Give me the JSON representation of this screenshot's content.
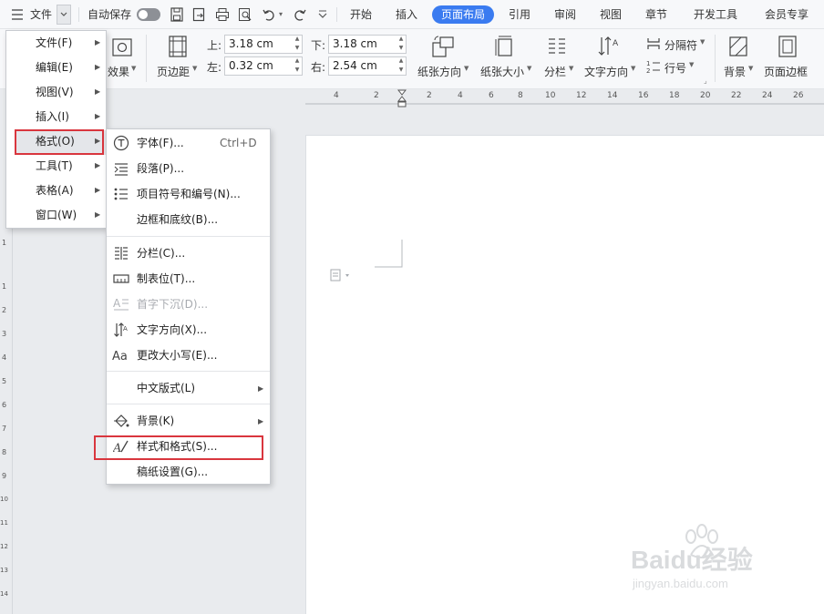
{
  "topbar": {
    "file_label": "文件",
    "autosave_label": "自动保存",
    "tabs": [
      "开始",
      "插入",
      "页面布局",
      "引用",
      "审阅",
      "视图",
      "章节",
      "开发工具",
      "会员专享"
    ],
    "active_tab": "页面布局"
  },
  "ribbon": {
    "effects_label": "效果",
    "margins_label": "页边距",
    "top_label": "上:",
    "top_value": "3.18 cm",
    "bottom_label": "下:",
    "bottom_value": "3.18 cm",
    "left_label": "左:",
    "left_value": "0.32 cm",
    "right_label": "右:",
    "right_value": "2.54 cm",
    "orientation_label": "纸张方向",
    "size_label": "纸张大小",
    "columns_label": "分栏",
    "text_direction_label": "文字方向",
    "separator_label": "分隔符",
    "line_number_label": "行号",
    "background_label": "背景",
    "page_border_label": "页面边框"
  },
  "ruler": {
    "h_numbers": [
      "4",
      "2",
      "2",
      "4",
      "6",
      "8",
      "10",
      "12",
      "14",
      "16",
      "18",
      "20",
      "22",
      "24",
      "26"
    ],
    "v_numbers": [
      "1",
      "1",
      "2",
      "3",
      "4",
      "5",
      "6",
      "7",
      "8",
      "9",
      "10",
      "11",
      "12",
      "13",
      "14"
    ]
  },
  "main_menu": {
    "items": [
      {
        "label": "文件(F)"
      },
      {
        "label": "编辑(E)"
      },
      {
        "label": "视图(V)"
      },
      {
        "label": "插入(I)"
      },
      {
        "label": "格式(O)"
      },
      {
        "label": "工具(T)"
      },
      {
        "label": "表格(A)"
      },
      {
        "label": "窗口(W)"
      }
    ]
  },
  "format_menu": {
    "items": [
      {
        "label": "字体(F)...",
        "shortcut": "Ctrl+D"
      },
      {
        "label": "段落(P)..."
      },
      {
        "label": "项目符号和编号(N)..."
      },
      {
        "label": "边框和底纹(B)..."
      },
      {
        "label": "分栏(C)..."
      },
      {
        "label": "制表位(T)..."
      },
      {
        "label": "首字下沉(D)..."
      },
      {
        "label": "文字方向(X)..."
      },
      {
        "label": "更改大小写(E)..."
      },
      {
        "label": "中文版式(L)"
      },
      {
        "label": "背景(K)"
      },
      {
        "label": "样式和格式(S)..."
      },
      {
        "label": "稿纸设置(G)..."
      }
    ]
  },
  "watermark": {
    "brand": "Baidu经验",
    "url": "jingyan.baidu.com"
  },
  "colors": {
    "accent": "#3a7bf0",
    "highlight_box": "#d9363e"
  }
}
